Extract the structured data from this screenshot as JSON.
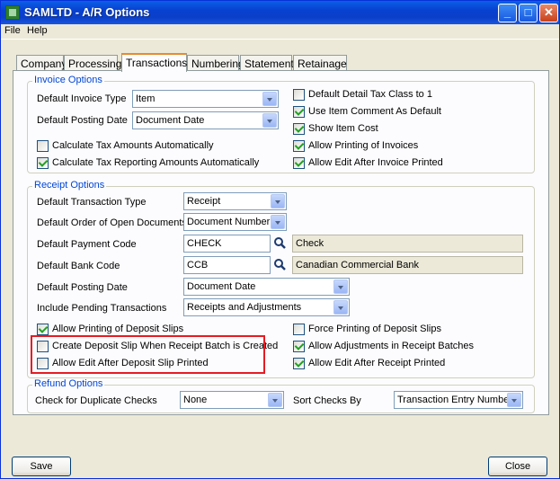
{
  "window": {
    "title": "SAMLTD - A/R Options",
    "icon": "app-icon",
    "controls": {
      "minimize": "_",
      "maximize": "□",
      "close": "✕"
    }
  },
  "menu": [
    {
      "label": "File"
    },
    {
      "label": "Help"
    }
  ],
  "tabs": [
    {
      "label": "Company"
    },
    {
      "label": "Processing"
    },
    {
      "label": "Transactions",
      "active": true
    },
    {
      "label": "Numbering"
    },
    {
      "label": "Statement"
    },
    {
      "label": "Retainage"
    }
  ],
  "invoice_options": {
    "title": "Invoice Options",
    "default_invoice_type": {
      "label": "Default Invoice Type",
      "value": "Item"
    },
    "default_posting_date": {
      "label": "Default Posting Date",
      "value": "Document Date"
    },
    "calc_tax_amounts": {
      "label": "Calculate Tax Amounts Automatically",
      "checked": false
    },
    "calc_tax_reporting": {
      "label": "Calculate Tax Reporting Amounts Automatically",
      "checked": true
    },
    "default_detail_tax_class": {
      "label": "Default Detail Tax Class to 1",
      "checked": false
    },
    "use_item_comment": {
      "label": "Use Item Comment As Default",
      "checked": true
    },
    "show_item_cost": {
      "label": "Show Item Cost",
      "checked": true
    },
    "allow_printing_invoices": {
      "label": "Allow Printing of Invoices",
      "checked": true
    },
    "allow_edit_after_invoice": {
      "label": "Allow Edit After Invoice Printed",
      "checked": true
    }
  },
  "receipt_options": {
    "title": "Receipt Options",
    "default_transaction_type": {
      "label": "Default Transaction Type",
      "value": "Receipt"
    },
    "default_order_open_docs": {
      "label": "Default Order of Open Documents",
      "value": "Document Number"
    },
    "default_payment_code": {
      "label": "Default Payment Code",
      "value": "CHECK",
      "description": "Check"
    },
    "default_bank_code": {
      "label": "Default Bank Code",
      "value": "CCB",
      "description": "Canadian Commercial Bank"
    },
    "default_posting_date": {
      "label": "Default Posting Date",
      "value": "Document Date"
    },
    "include_pending": {
      "label": "Include Pending Transactions",
      "value": "Receipts and Adjustments"
    },
    "allow_printing_deposit_slips": {
      "label": "Allow Printing of Deposit Slips",
      "checked": true
    },
    "create_deposit_slip": {
      "label": "Create Deposit Slip When Receipt Batch is Created",
      "checked": false
    },
    "allow_edit_after_deposit": {
      "label": "Allow Edit After Deposit Slip Printed",
      "checked": false
    },
    "force_printing_deposit_slips": {
      "label": "Force Printing of Deposit Slips",
      "checked": false
    },
    "allow_adjustments": {
      "label": "Allow Adjustments in Receipt Batches",
      "checked": true
    },
    "allow_edit_after_receipt": {
      "label": "Allow Edit After Receipt Printed",
      "checked": true
    }
  },
  "refund_options": {
    "title": "Refund Options",
    "check_duplicate": {
      "label": "Check for Duplicate Checks",
      "value": "None"
    },
    "sort_checks_by": {
      "label": "Sort Checks By",
      "value": "Transaction Entry Number"
    }
  },
  "buttons": {
    "save": "Save",
    "close": "Close"
  },
  "colors": {
    "group_title": "#0046d5",
    "highlight": "#e51c23",
    "title_bar": "#0a5fe8"
  }
}
